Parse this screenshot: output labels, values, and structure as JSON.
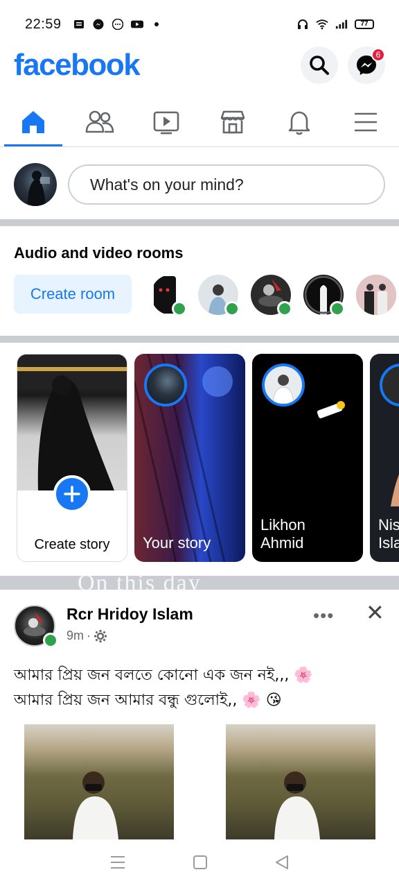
{
  "status_bar": {
    "time": "22:59",
    "battery": "77",
    "icons_left": [
      "notification-icon",
      "messenger-icon",
      "chat-icon",
      "youtube-icon",
      "dot-icon"
    ],
    "icons_right": [
      "headphones-icon",
      "wifi-icon",
      "signal-icon",
      "battery-icon"
    ]
  },
  "header": {
    "logo": "facebook",
    "search_icon": "search-icon",
    "messenger_icon": "messenger-icon",
    "messenger_badge": "6"
  },
  "tabs": [
    {
      "name": "home",
      "icon": "home-icon",
      "active": true
    },
    {
      "name": "friends",
      "icon": "friends-icon",
      "active": false
    },
    {
      "name": "watch",
      "icon": "video-icon",
      "active": false
    },
    {
      "name": "marketplace",
      "icon": "store-icon",
      "active": false
    },
    {
      "name": "notifications",
      "icon": "bell-icon",
      "active": false
    },
    {
      "name": "menu",
      "icon": "menu-icon",
      "active": false
    }
  ],
  "composer": {
    "placeholder": "What's on your mind?"
  },
  "rooms": {
    "title": "Audio and video rooms",
    "create_label": "Create room"
  },
  "stories": {
    "create_label": "Create story",
    "your_story_label": "Your story",
    "items": [
      {
        "name": "Likhon\nAhmid"
      },
      {
        "name": "Nis\nIsla"
      }
    ]
  },
  "on_this_day": "On this day",
  "post": {
    "author": "Rcr Hridoy Islam",
    "time": "9m",
    "privacy_icon": "gear-icon",
    "line1": "আমার প্রিয় জন বলতে কোনো এক জন নই,,, 🌸",
    "line2": "আমার প্রিয় জন আমার বন্ধু গুলোই,, 🌸 😘",
    "more": "•••",
    "close": "✕"
  },
  "nav": {
    "recent_icon": "recent-apps-icon",
    "home_icon": "home-button-icon",
    "back_icon": "back-icon"
  },
  "colors": {
    "brand": "#1877f2",
    "online": "#31a24c",
    "badge": "#e41e3f"
  }
}
